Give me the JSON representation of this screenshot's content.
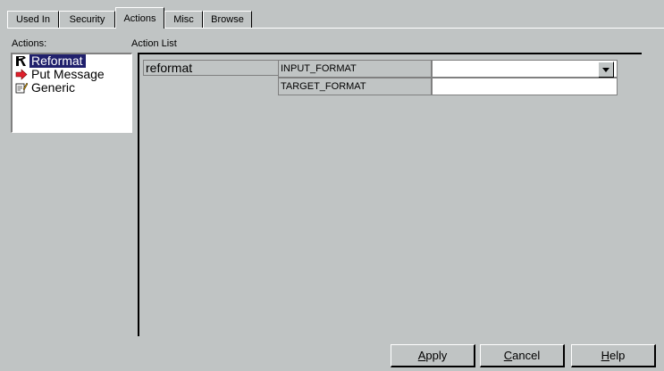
{
  "tabs": [
    {
      "label": "Used In",
      "active": false
    },
    {
      "label": "Security",
      "active": false
    },
    {
      "label": "Actions",
      "active": true
    },
    {
      "label": "Misc",
      "active": false
    },
    {
      "label": "Browse",
      "active": false
    }
  ],
  "labels": {
    "actions": "Actions:",
    "action_list": "Action List"
  },
  "actions": [
    {
      "label": "Reformat",
      "icon": "reformat-icon",
      "selected": true
    },
    {
      "label": "Put Message",
      "icon": "arrow-right-icon",
      "selected": false
    },
    {
      "label": "Generic",
      "icon": "document-pencil-icon",
      "selected": false
    }
  ],
  "action_list": {
    "action_name": "reformat",
    "params": [
      {
        "name": "INPUT_FORMAT",
        "value": "",
        "control": "combo"
      },
      {
        "name": "TARGET_FORMAT",
        "value": "",
        "control": "text"
      }
    ]
  },
  "buttons": {
    "apply": {
      "mnemonic": "A",
      "rest": "pply"
    },
    "cancel": {
      "mnemonic": "C",
      "rest": "ancel"
    },
    "help": {
      "mnemonic": "H",
      "rest": "elp"
    }
  },
  "colors": {
    "background": "#c0c4c4",
    "selection": "#20206c"
  }
}
